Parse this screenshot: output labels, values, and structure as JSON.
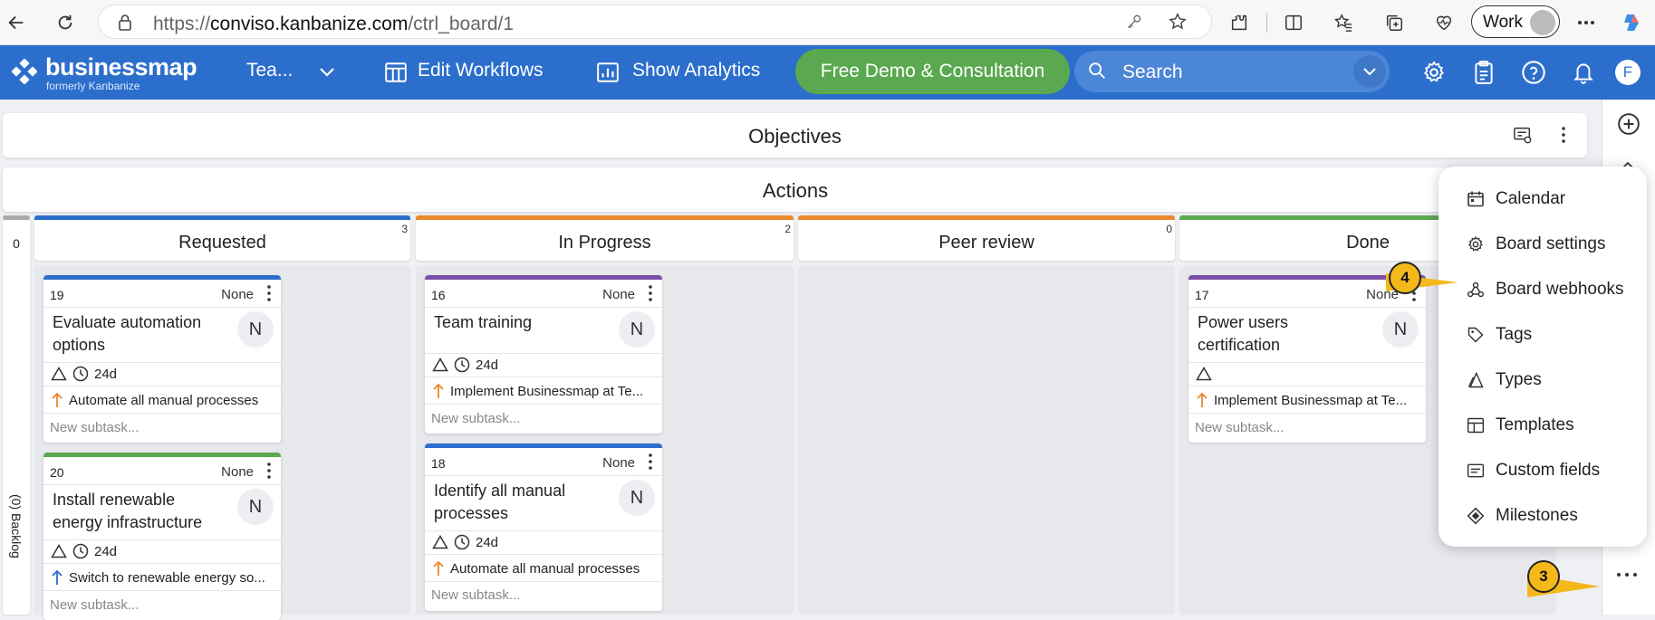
{
  "browser": {
    "url_prefix": "https://",
    "url_host": "conviso.kanbanize.com",
    "url_path": "/ctrl_board/1",
    "profile_label": "Work"
  },
  "app": {
    "logo_name": "businessmap",
    "logo_sub": "formerly Kanbanize",
    "workspace_label": "Tea...",
    "edit_workflows": "Edit Workflows",
    "show_analytics": "Show Analytics",
    "demo_button": "Free Demo & Consultation",
    "search_placeholder": "Search",
    "user_initial": "F",
    "brand_color": "#2c6ecb",
    "demo_color": "#5aa84f"
  },
  "board": {
    "objectives_title": "Objectives",
    "actions_title": "Actions",
    "backlog": {
      "count": "0",
      "label": "(0) Backlog"
    },
    "columns": [
      {
        "name": "Requested",
        "wip": "3",
        "color": "#2c6ecb"
      },
      {
        "name": "In Progress",
        "wip": "2",
        "color": "#e8892c"
      },
      {
        "name": "Peer review",
        "wip": "0",
        "color": "#e8892c"
      },
      {
        "name": "Done",
        "wip": "",
        "color": "#5aa84f"
      }
    ],
    "cards": [
      {
        "id": "19",
        "priority": "None",
        "title": "Evaluate automation options",
        "avatar": "N",
        "age": "24d",
        "parent": "Automate all manual processes",
        "subtask": "New subtask...",
        "color": "#2c6ecb"
      },
      {
        "id": "20",
        "priority": "None",
        "title": "Install renewable energy infrastructure",
        "avatar": "N",
        "age": "24d",
        "parent": "Switch to renewable energy so...",
        "subtask": "New subtask...",
        "color": "#5aa84f"
      },
      {
        "id": "16",
        "priority": "None",
        "title": "Team training",
        "avatar": "N",
        "age": "24d",
        "parent": "Implement Businessmap at Te...",
        "subtask": "New subtask...",
        "color": "#7b4fa6"
      },
      {
        "id": "18",
        "priority": "None",
        "title": "Identify all manual processes",
        "avatar": "N",
        "age": "24d",
        "parent": "Automate all manual processes",
        "subtask": "New subtask...",
        "color": "#2c6ecb"
      },
      {
        "id": "17",
        "priority": "None",
        "title": "Power users certification",
        "avatar": "N",
        "parent": "Implement Businessmap at Te...",
        "subtask": "New subtask...",
        "color": "#7b4fa6"
      }
    ]
  },
  "popup_menu": {
    "items": [
      {
        "label": "Calendar",
        "icon": "calendar-icon"
      },
      {
        "label": "Board settings",
        "icon": "gear-icon"
      },
      {
        "label": "Board webhooks",
        "icon": "webhook-icon"
      },
      {
        "label": "Tags",
        "icon": "tag-icon"
      },
      {
        "label": "Types",
        "icon": "types-icon"
      },
      {
        "label": "Templates",
        "icon": "template-icon"
      },
      {
        "label": "Custom fields",
        "icon": "custom-fields-icon"
      },
      {
        "label": "Milestones",
        "icon": "milestone-icon"
      }
    ]
  },
  "callouts": {
    "step3": "3",
    "step4": "4",
    "color": "#f5b81a"
  }
}
